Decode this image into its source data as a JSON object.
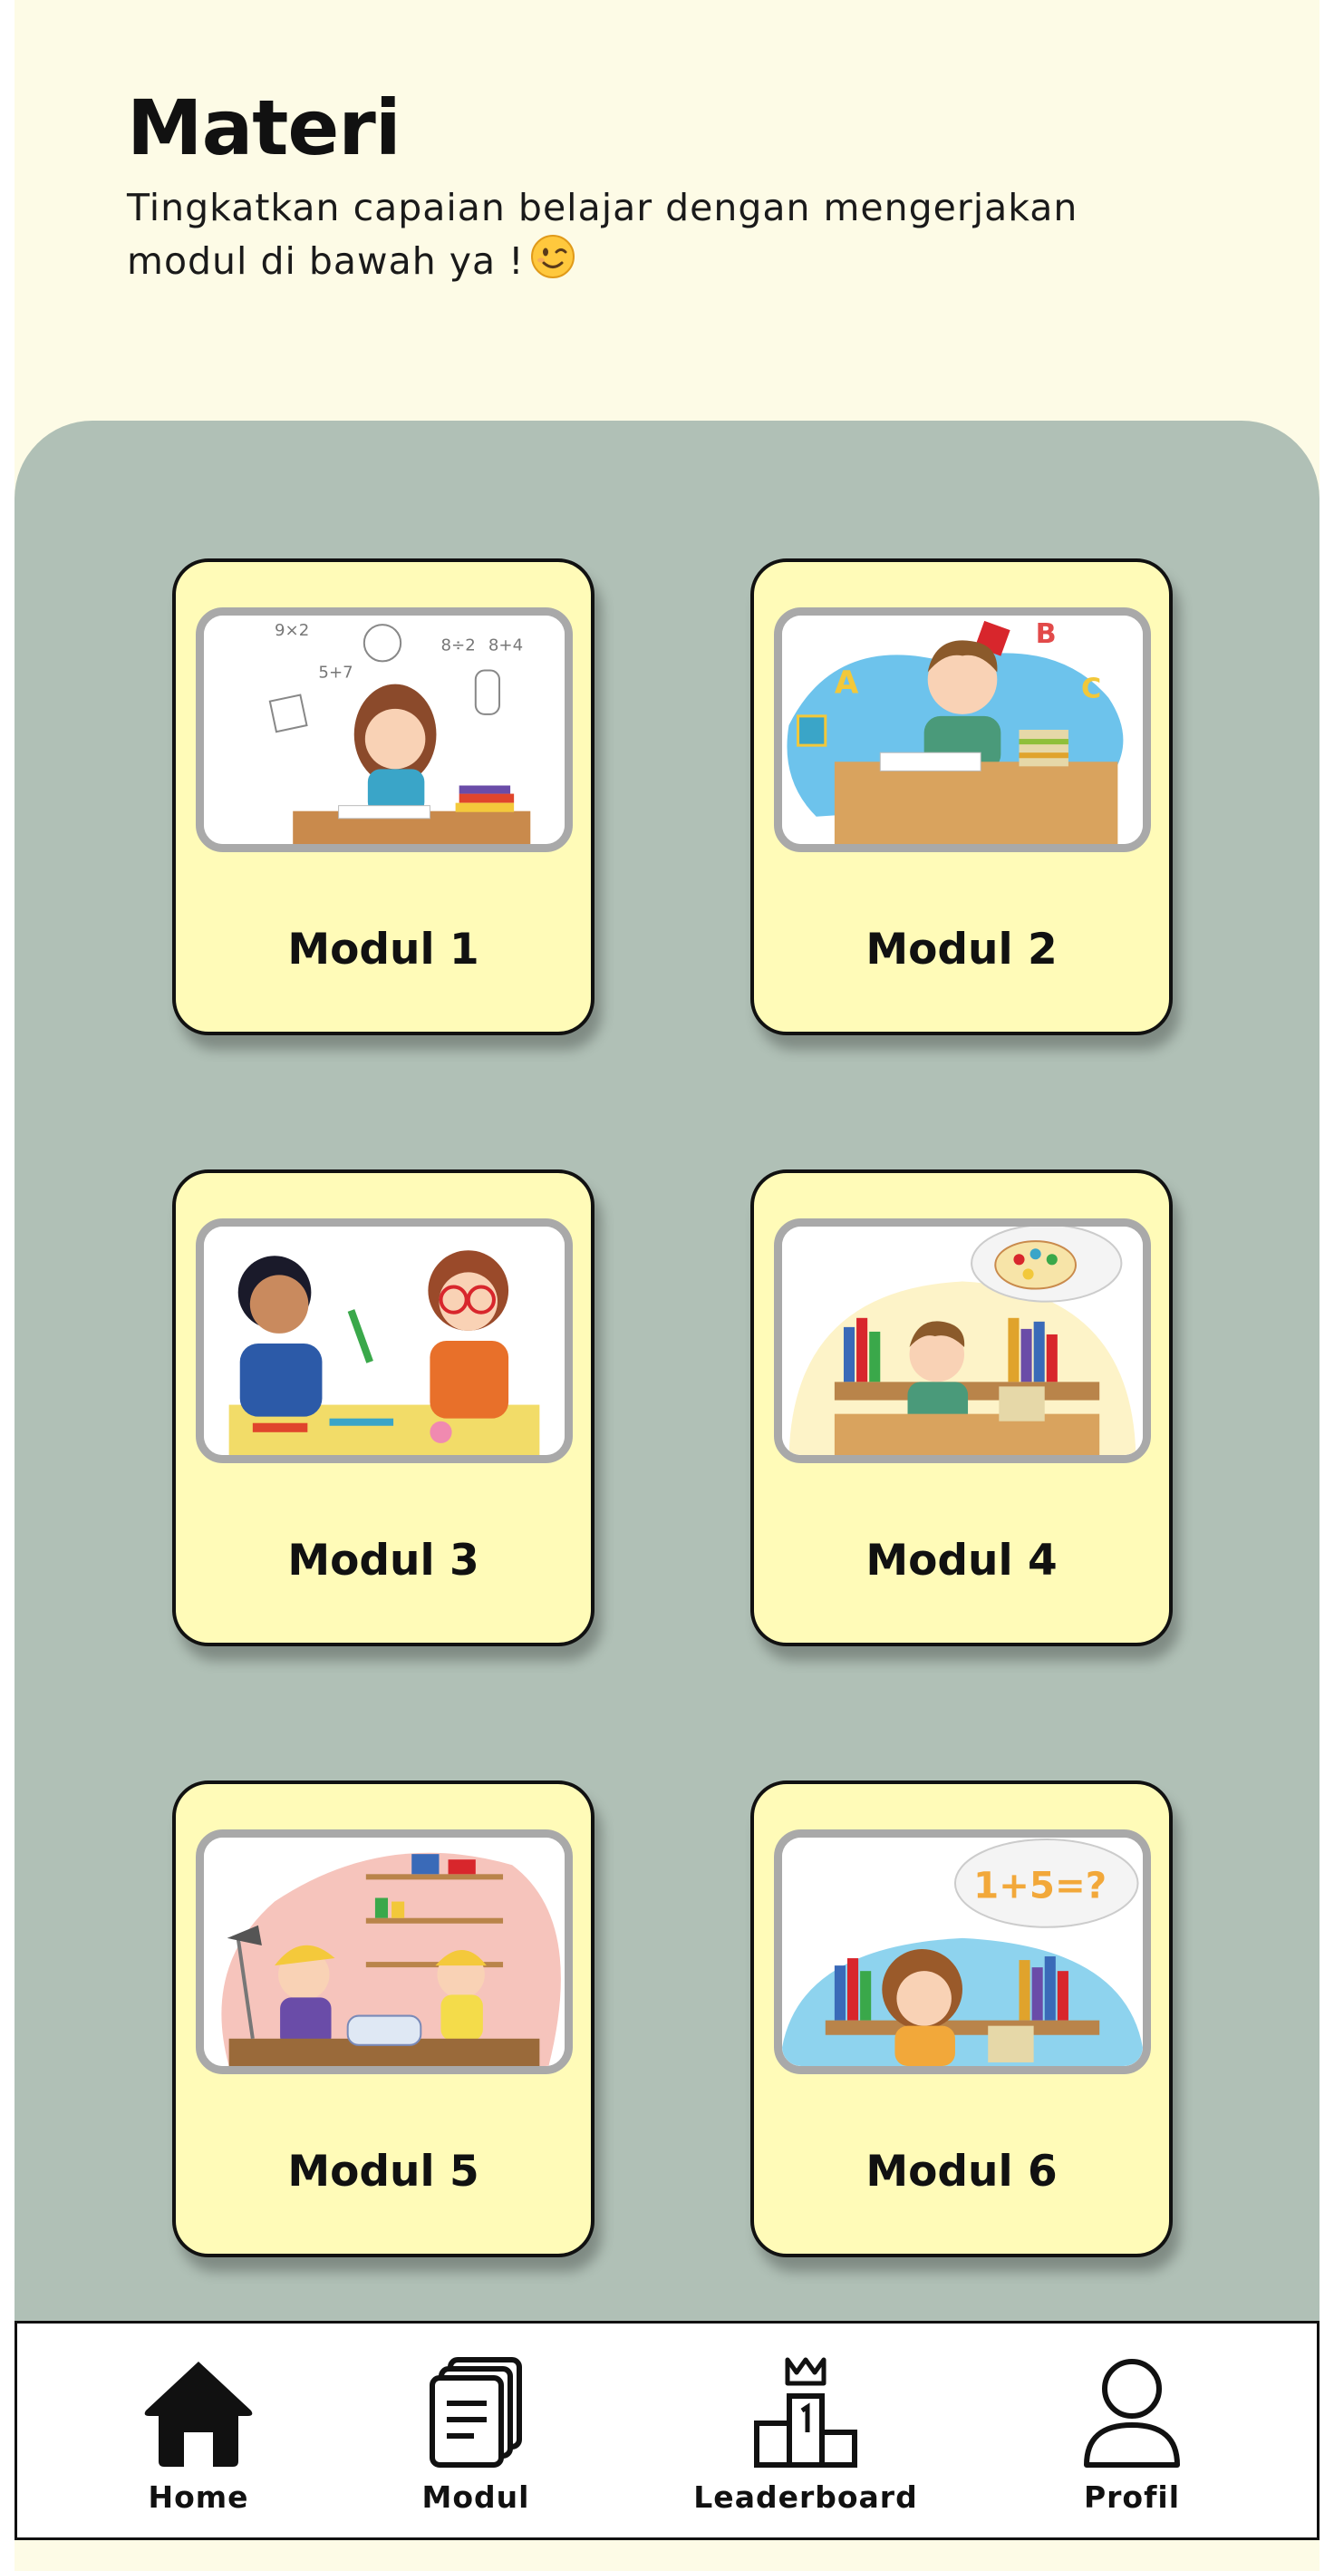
{
  "header": {
    "title": "Materi",
    "subtitle": "Tingkatkan capaian belajar dengan mengerjakan modul di bawah ya !"
  },
  "modules": [
    {
      "label": "Modul 1"
    },
    {
      "label": "Modul 2"
    },
    {
      "label": "Modul 3"
    },
    {
      "label": "Modul 4"
    },
    {
      "label": "Modul 5"
    },
    {
      "label": "Modul 6"
    }
  ],
  "math_doodles": {
    "a": "9×2",
    "b": "5+7",
    "c": "8÷2",
    "d": "8+4"
  },
  "letters": {
    "a": "A",
    "b": "B",
    "c": "C"
  },
  "equation": "1+5=?",
  "nav": [
    {
      "label": "Home",
      "icon": "home-icon"
    },
    {
      "label": "Modul",
      "icon": "documents-icon"
    },
    {
      "label": "Leaderboard",
      "icon": "podium-crown-icon"
    },
    {
      "label": "Profil",
      "icon": "user-icon"
    }
  ],
  "colors": {
    "background": "#fdfbe6",
    "panel": "#b0c0b6",
    "card": "#fffbb8",
    "card_border": "#111111",
    "image_frame": "#a9a9a9"
  }
}
